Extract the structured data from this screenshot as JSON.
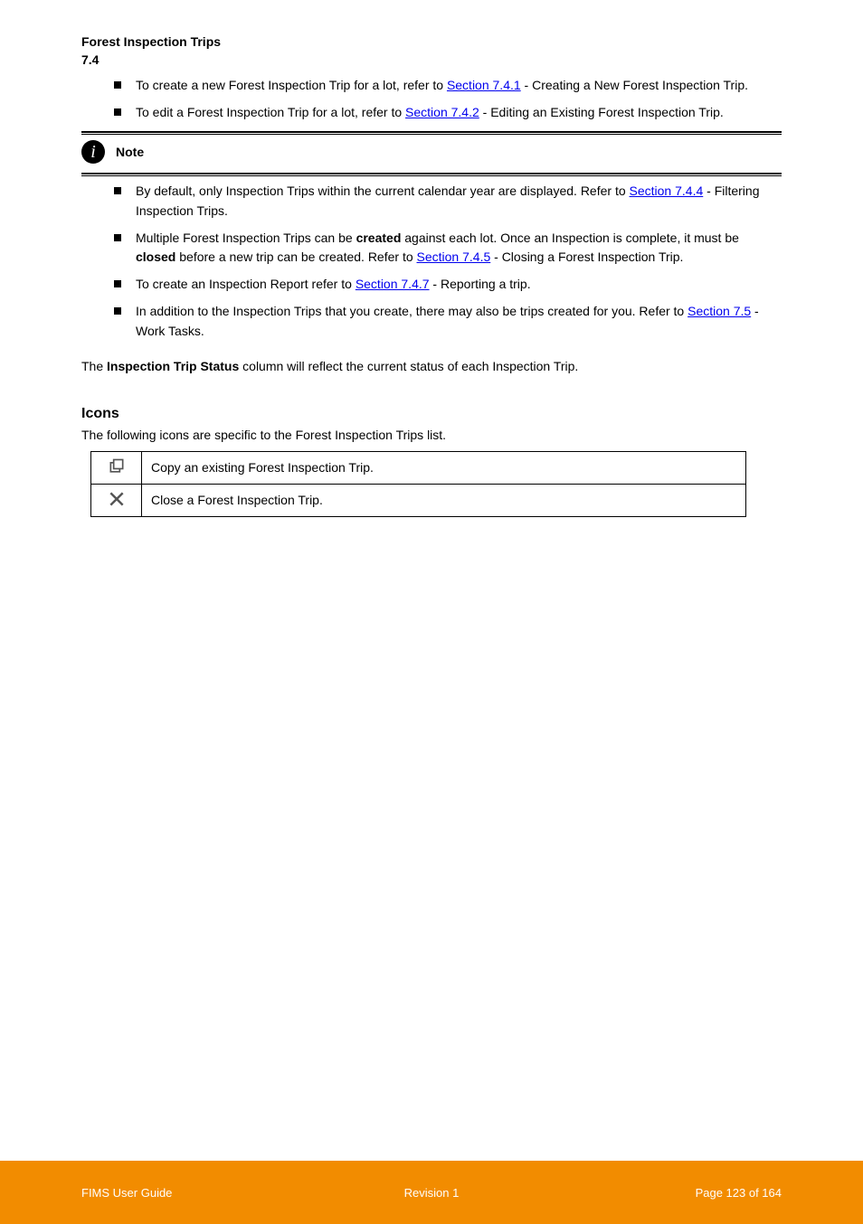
{
  "header": {
    "title": "Forest Inspection Trips",
    "section_id": "7.4"
  },
  "bullets1": [
    {
      "prefix": "To create a new Forest Inspection Trip for a lot, refer to ",
      "link": "Section 7.4.1",
      "suffix": " - Creating a New Forest Inspection Trip."
    },
    {
      "prefix": "To edit a Forest Inspection Trip for a lot, refer to ",
      "link": "Section 7.4.2",
      "suffix": " - Editing an Existing Forest Inspection Trip."
    }
  ],
  "note": {
    "label": "Note",
    "items": [
      {
        "parts": [
          {
            "text": "By default, only Inspection Trips within the current calendar year are displayed. Refer to "
          },
          {
            "link": "Section 7.4.4"
          },
          {
            "text": " - Filtering Inspection Trips."
          }
        ]
      },
      {
        "parts": [
          {
            "text": "Multiple Forest Inspection Trips can be "
          },
          {
            "bold": "created"
          },
          {
            "text": " against each lot. Once an Inspection is complete, it must be "
          },
          {
            "bold": "closed"
          },
          {
            "text": " before a new trip can be created. Refer to "
          },
          {
            "link": "Section 7.4.5"
          },
          {
            "text": " - Closing a Forest Inspection Trip."
          }
        ]
      },
      {
        "parts": [
          {
            "text": "To create an Inspection Report refer to "
          },
          {
            "link": "Section 7.4.7"
          },
          {
            "text": " - Reporting a trip."
          }
        ]
      },
      {
        "parts": [
          {
            "text": "In addition to the Inspection Trips that you create, there may also be trips created for you. Refer to "
          },
          {
            "link": "Section 7.5"
          },
          {
            "text": " - Work Tasks."
          }
        ]
      }
    ]
  },
  "paragraph": {
    "pre": "The ",
    "col": "Inspection Trip Status",
    "post": " column will reflect the current status of each Inspection Trip."
  },
  "icons_section": {
    "title": "Icons",
    "intro": "The following icons are specific to the Forest Inspection Trips list.",
    "rows": [
      {
        "icon": "copy-icon",
        "text": "Copy an existing Forest Inspection Trip."
      },
      {
        "icon": "close-icon",
        "text": "Close a Forest Inspection Trip."
      }
    ]
  },
  "footer": {
    "left": "FIMS User Guide",
    "center": "Revision 1",
    "right": "Page 123 of 164"
  }
}
